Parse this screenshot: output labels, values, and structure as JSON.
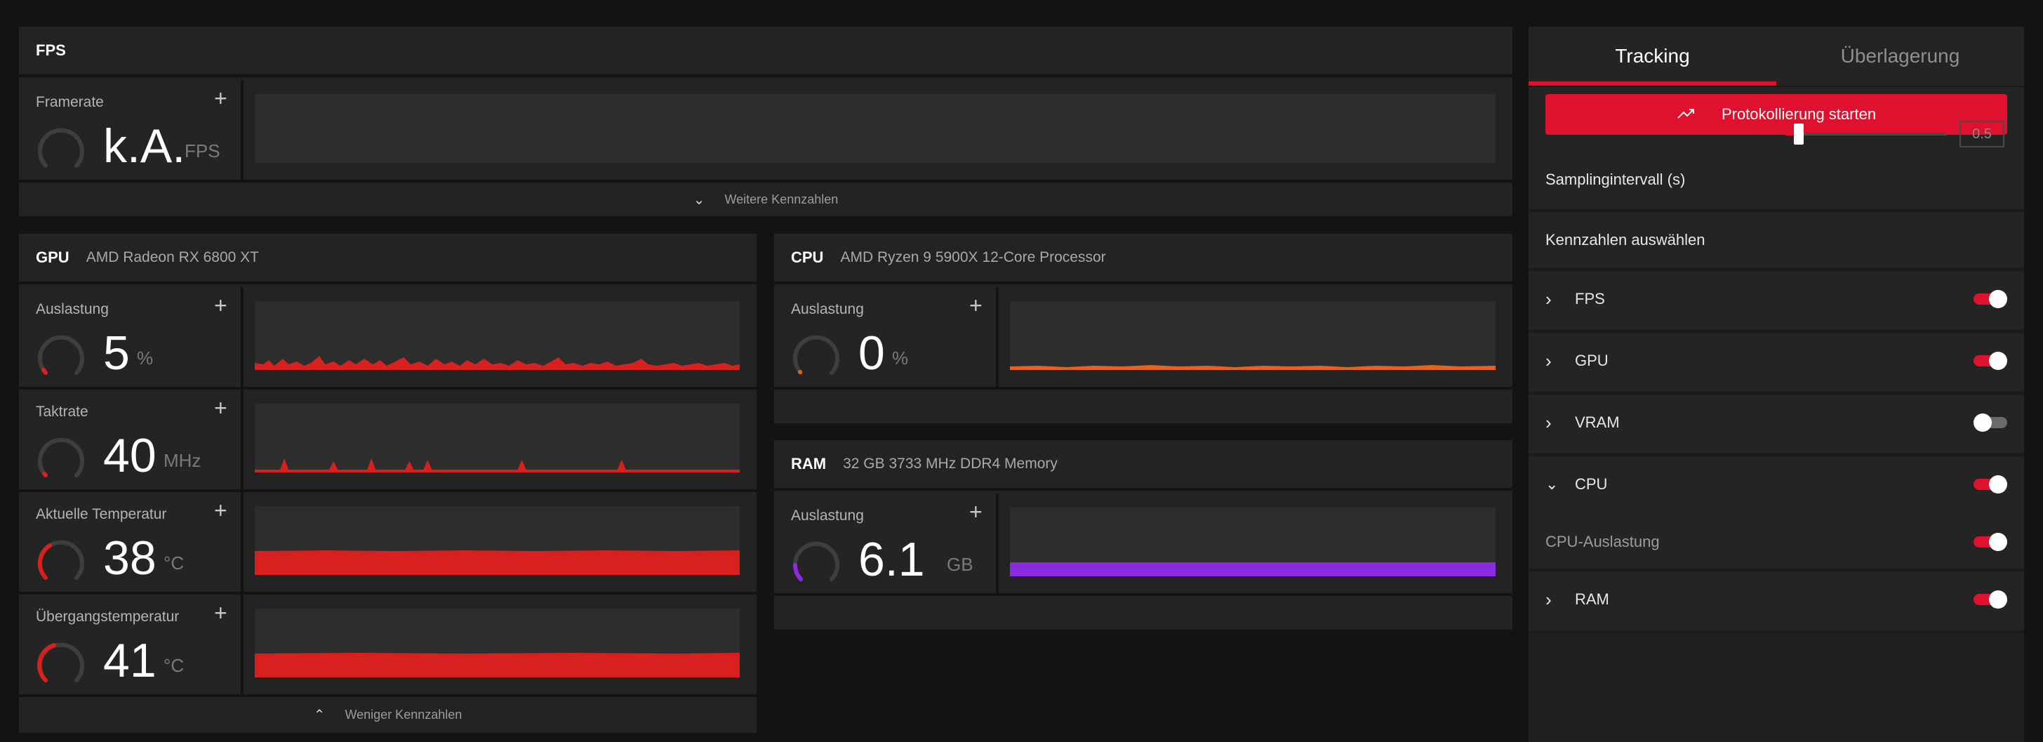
{
  "colors": {
    "accent": "#e0102f",
    "gpu_graph": "#d8201f",
    "cpu_graph": "#e8621a",
    "ram_graph": "#8a2be2",
    "panel": "#232323",
    "background": "#131313"
  },
  "fps_panel": {
    "title": "FPS",
    "metric": {
      "label": "Framerate",
      "value": "k.A.",
      "unit": "FPS"
    },
    "footer": "Weitere Kennzahlen"
  },
  "gpu_panel": {
    "title": "GPU",
    "device": "AMD Radeon RX 6800 XT",
    "metrics": [
      {
        "label": "Auslastung",
        "value": "5",
        "unit": "%",
        "gauge_fraction": 0.05
      },
      {
        "label": "Taktrate",
        "value": "40",
        "unit": "MHz",
        "gauge_fraction": 0.02
      },
      {
        "label": "Aktuelle Temperatur",
        "value": "38",
        "unit": "°C",
        "gauge_fraction": 0.38
      },
      {
        "label": "Übergangstemperatur",
        "value": "41",
        "unit": "°C",
        "gauge_fraction": 0.41
      }
    ],
    "footer": "Weniger Kennzahlen"
  },
  "cpu_panel": {
    "title": "CPU",
    "device": "AMD Ryzen 9 5900X 12-Core Processor",
    "metric": {
      "label": "Auslastung",
      "value": "0",
      "unit": "%",
      "gauge_fraction": 0.01
    }
  },
  "ram_panel": {
    "title": "RAM",
    "device": "32 GB 3733 MHz DDR4 Memory",
    "metric": {
      "label": "Auslastung",
      "value": "6.1",
      "unit": "GB",
      "gauge_fraction": 0.19
    }
  },
  "sidebar": {
    "tabs": [
      {
        "label": "Tracking",
        "active": true
      },
      {
        "label": "Überlagerung",
        "active": false
      }
    ],
    "record_button": "Protokollierung starten",
    "sampling_label": "Samplingintervall (s)",
    "sampling_value": "0.5",
    "select_header": "Kennzahlen auswählen",
    "items": [
      {
        "label": "FPS",
        "expanded": false,
        "enabled": true
      },
      {
        "label": "GPU",
        "expanded": false,
        "enabled": true
      },
      {
        "label": "VRAM",
        "expanded": false,
        "enabled": false
      },
      {
        "label": "CPU",
        "expanded": true,
        "enabled": true
      },
      {
        "label": "CPU-Auslastung",
        "sub": true,
        "enabled": true
      },
      {
        "label": "RAM",
        "expanded": false,
        "enabled": true
      }
    ]
  }
}
